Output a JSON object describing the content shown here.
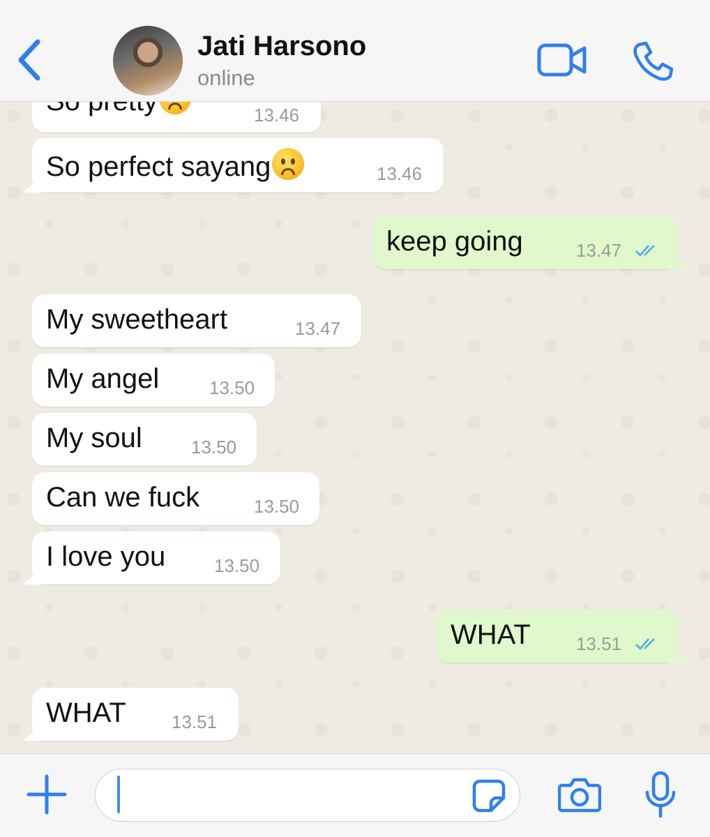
{
  "header": {
    "contact_name": "Jati Harsono",
    "status": "online",
    "back_icon": "chevron-left-icon",
    "video_icon": "video-camera-icon",
    "call_icon": "phone-icon"
  },
  "messages": [
    {
      "direction": "in",
      "text": "So pretty",
      "emoji": "frowning-face",
      "time": "13.46"
    },
    {
      "direction": "in",
      "text": "So perfect sayang",
      "emoji": "frowning-face",
      "time": "13.46"
    },
    {
      "direction": "out",
      "text": "keep going",
      "time": "13.47",
      "read": true
    },
    {
      "direction": "in",
      "text": "My sweetheart",
      "time": "13.47"
    },
    {
      "direction": "in",
      "text": "My angel",
      "time": "13.50"
    },
    {
      "direction": "in",
      "text": "My soul",
      "time": "13.50"
    },
    {
      "direction": "in",
      "text": "Can we fuck",
      "time": "13.50"
    },
    {
      "direction": "in",
      "text": "I love you",
      "time": "13.50"
    },
    {
      "direction": "out",
      "text": "WHAT",
      "time": "13.51",
      "read": true
    },
    {
      "direction": "in",
      "text": "WHAT",
      "time": "13.51"
    }
  ],
  "composer": {
    "text": "",
    "plus_icon": "plus-icon",
    "sticker_icon": "sticker-icon",
    "camera_icon": "camera-icon",
    "mic_icon": "microphone-icon"
  },
  "colors": {
    "accent": "#2f80ed",
    "incoming_bubble": "#ffffff",
    "outgoing_bubble": "#e1f8cc",
    "read_ticks": "#4fa8e8"
  }
}
